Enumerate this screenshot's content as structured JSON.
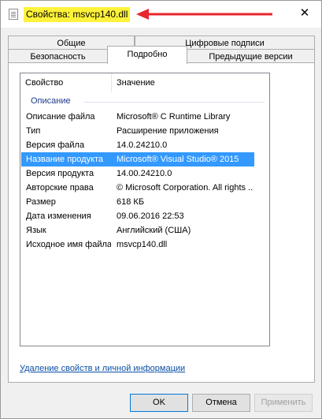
{
  "window": {
    "title": "Свойства: msvcp140.dll",
    "close_glyph": "✕",
    "annotation_color": "#e8262c",
    "highlight_color": "#fff23a"
  },
  "tabs": {
    "row_back": [
      "Общие",
      "Цифровые подписи"
    ],
    "row_front": [
      "Безопасность",
      "Подробно",
      "Предыдущие версии"
    ],
    "active": "Подробно"
  },
  "details": {
    "columns": [
      "Свойство",
      "Значение"
    ],
    "group": "Описание",
    "rows": [
      {
        "name": "Описание файла",
        "value": "Microsoft® C Runtime Library"
      },
      {
        "name": "Тип",
        "value": "Расширение приложения"
      },
      {
        "name": "Версия файла",
        "value": "14.0.24210.0"
      },
      {
        "name": "Название продукта",
        "value": "Microsoft® Visual Studio® 2015",
        "selected": true
      },
      {
        "name": "Версия продукта",
        "value": "14.00.24210.0"
      },
      {
        "name": "Авторские права",
        "value": "© Microsoft Corporation. All rights ..."
      },
      {
        "name": "Размер",
        "value": "618 КБ"
      },
      {
        "name": "Дата изменения",
        "value": "09.06.2016 22:53"
      },
      {
        "name": "Язык",
        "value": "Английский (США)"
      },
      {
        "name": "Исходное имя файла",
        "value": "msvcp140.dll"
      }
    ],
    "selection_color": "#3399ff"
  },
  "footer": {
    "remove_link": "Удаление свойств и личной информации"
  },
  "buttons": {
    "ok": "OK",
    "cancel": "Отмена",
    "apply": "Применить"
  }
}
